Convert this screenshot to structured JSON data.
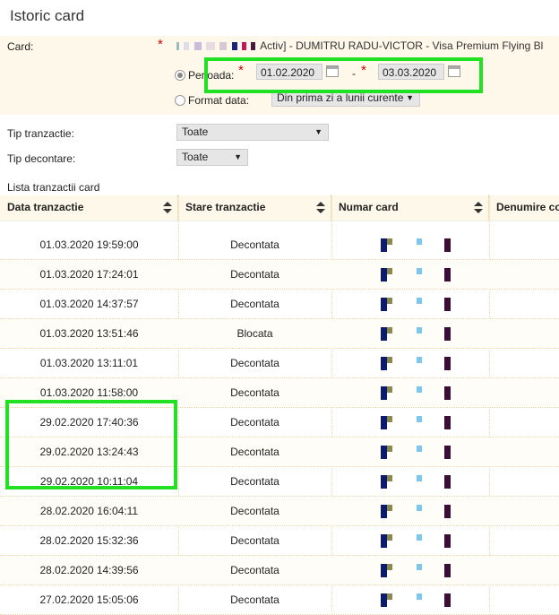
{
  "page": {
    "title": "Istoric card"
  },
  "form": {
    "card_label": "Card:",
    "card_value": "Activ] - DUMITRU RADU-VICTOR - Visa Premium Flying Bl",
    "perioada_label": "Perioada:",
    "date_from": "01.02.2020",
    "date_separator": "-",
    "date_to": "03.03.2020",
    "format_label": "Format data:",
    "format_value": "Din prima zi a lunii curente",
    "tip_tranzactie_label": "Tip tranzactie:",
    "tip_tranzactie_value": "Toate",
    "tip_decontare_label": "Tip decontare:",
    "tip_decontare_value": "Toate"
  },
  "list": {
    "caption": "Lista tranzactii card",
    "columns": [
      "Data tranzactie",
      "Stare tranzactie",
      "Numar card",
      "Denumire co"
    ],
    "rows": [
      {
        "date": "01.03.2020 19:59:00",
        "status": "Decontata"
      },
      {
        "date": "01.03.2020 17:24:01",
        "status": "Decontata"
      },
      {
        "date": "01.03.2020 14:37:57",
        "status": "Decontata"
      },
      {
        "date": "01.03.2020 13:51:46",
        "status": "Blocata"
      },
      {
        "date": "01.03.2020 13:11:01",
        "status": "Decontata"
      },
      {
        "date": "01.03.2020 11:58:00",
        "status": "Decontata"
      },
      {
        "date": "29.02.2020 17:40:36",
        "status": "Decontata"
      },
      {
        "date": "29.02.2020 13:24:43",
        "status": "Decontata"
      },
      {
        "date": "29.02.2020 10:11:04",
        "status": "Decontata"
      },
      {
        "date": "28.02.2020 16:04:11",
        "status": "Decontata"
      },
      {
        "date": "28.02.2020 15:32:36",
        "status": "Decontata"
      },
      {
        "date": "28.02.2020 14:39:56",
        "status": "Decontata"
      },
      {
        "date": "27.02.2020 15:05:06",
        "status": "Decontata"
      }
    ]
  },
  "colors": {
    "highlight": "#22e022",
    "required": "#cc0000",
    "band": "#fdf8ea"
  }
}
